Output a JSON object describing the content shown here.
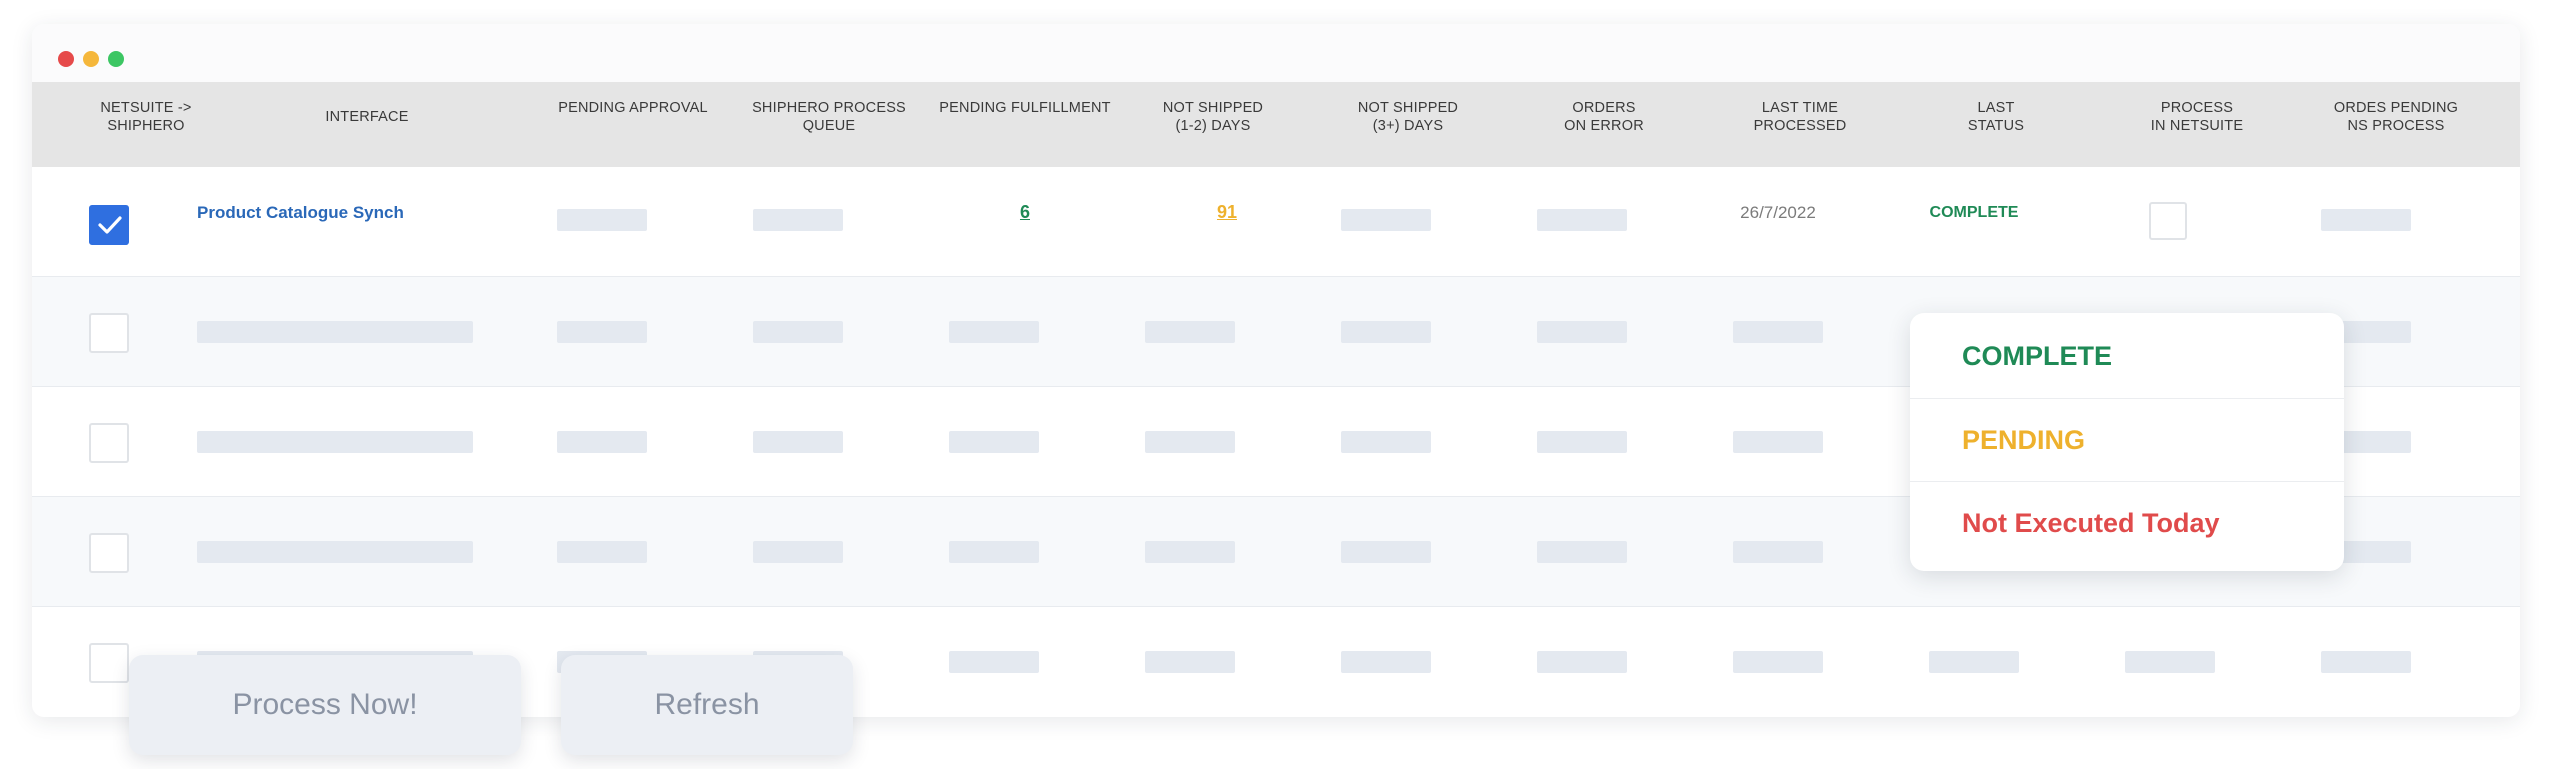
{
  "window": {
    "controls": [
      "close",
      "minimize",
      "maximize"
    ]
  },
  "colors": {
    "complete": "#1f8a56",
    "pending": "#eeb12d",
    "not_executed": "#e04b4b",
    "link": "#2a68b8",
    "checkbox": "#2f6fe0"
  },
  "table": {
    "headers": [
      {
        "line1": "NETSUITE ->",
        "line2": "SHIPHERO"
      },
      {
        "line1": "INTERFACE",
        "line2": ""
      },
      {
        "line1": "PENDING APPROVAL",
        "line2": ""
      },
      {
        "line1": "SHIPHERO PROCESS",
        "line2": "QUEUE"
      },
      {
        "line1": "PENDING FULFILLMENT",
        "line2": ""
      },
      {
        "line1": "NOT SHIPPED",
        "line2": "(1-2) DAYS"
      },
      {
        "line1": "NOT SHIPPED",
        "line2": "(3+) DAYS"
      },
      {
        "line1": "ORDERS",
        "line2": "ON ERROR"
      },
      {
        "line1": "LAST TIME",
        "line2": "PROCESSED"
      },
      {
        "line1": "LAST",
        "line2": "STATUS"
      },
      {
        "line1": "PROCESS",
        "line2": "IN NETSUITE"
      },
      {
        "line1": "ORDES PENDING",
        "line2": "NS PROCESS"
      }
    ],
    "first_row": {
      "checked": true,
      "interface": "Product Catalogue Synch",
      "pending_fulfillment": "6",
      "not_shipped_1_2": "91",
      "last_time_processed": "26/7/2022",
      "last_status": "COMPLETE"
    }
  },
  "status_dropdown": {
    "options": [
      {
        "label": "COMPLETE"
      },
      {
        "label": "PENDING"
      },
      {
        "label": "Not Executed Today"
      }
    ]
  },
  "actions": {
    "process_now": "Process Now!",
    "refresh": "Refresh"
  },
  "icons": {
    "checkbox": "check-icon"
  }
}
